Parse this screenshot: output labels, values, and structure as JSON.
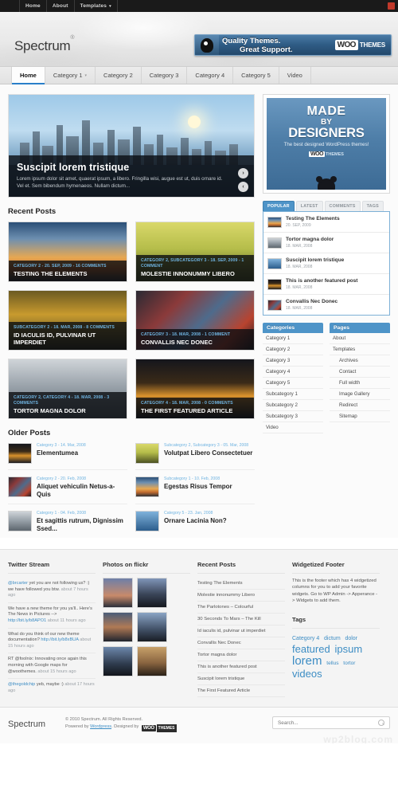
{
  "adminbar": {
    "items": [
      "Home",
      "About",
      "Templates"
    ],
    "templates_has_caret": true
  },
  "header": {
    "logo": "Spectrum",
    "logo_sup": "®",
    "ad": {
      "line1": "Quality Themes.",
      "line2": "Great Support.",
      "brand_woo": "WOO",
      "brand_themes": "THEMES"
    }
  },
  "nav": {
    "items": [
      "Home",
      "Category 1",
      "Category 2",
      "Category 3",
      "Category 4",
      "Category 5",
      "Video"
    ],
    "active": "Home",
    "caret_on": "Category 1"
  },
  "slider": {
    "title": "Suscipit lorem tristique",
    "excerpt": "Lorem ipsum dolor sit amet, quaerat ipsum, a libero. Fringilla wisi, augue est ut, duis ornare id. Vel et. Sem bibendum hymenaeos. Nullam dictum...",
    "next": "›",
    "prev": "‹"
  },
  "recent_posts": {
    "title": "Recent Posts",
    "items": [
      {
        "cat": "CATEGORY 2 - 20. SEP, 2009 - 16 COMMENTS",
        "title": "TESTING THE ELEMENTS",
        "art": "art-sunset"
      },
      {
        "cat": "CATEGORY 2, SUBCATEGORY 3 - 18. SEP, 2009 - 1 COMMENT",
        "title": "MOLESTIE INNONUMMY LIBERO",
        "art": "art-forest"
      },
      {
        "cat": "SUBCATEGORY 2 - 18. MAR, 2008 - 8 COMMENTS",
        "title": "ID IACULIS ID, PULVINAR UT IMPERDIET",
        "art": "art-autumn"
      },
      {
        "cat": "CATEGORY 3 - 18. MAR, 2008 - 1 COMMENT",
        "title": "CONVALLIS NEC DONEC",
        "art": "art-city"
      },
      {
        "cat": "CATEGORY 2, CATEGORY 4 - 18. MAR, 2008 - 3 COMMENTS",
        "title": "TORTOR MAGNA DOLOR",
        "art": "art-grey"
      },
      {
        "cat": "CATEGORY 4 - 18. MAR, 2008 - 0 COMMENTS",
        "title": "THE FIRST FEATURED ARTICLE",
        "art": "art-night"
      }
    ]
  },
  "sidebar_ad": {
    "made": "MADE",
    "by": "BY",
    "designers": "DESIGNERS",
    "tagline": "The best designed WordPress themes!",
    "brand_woo": "WOO",
    "brand_themes": "THEMES"
  },
  "tabs_widget": {
    "tabs": [
      "POPULAR",
      "LATEST",
      "COMMENTS",
      "TAGS"
    ],
    "active": "POPULAR",
    "items": [
      {
        "title": "Testing The Elements",
        "date": "20. SEP, 2009",
        "art": "art-sunset"
      },
      {
        "title": "Tortor magna dolor",
        "date": "18. MAR, 2008",
        "art": "art-grey"
      },
      {
        "title": "Suscipit lorem tristique",
        "date": "18. MAR, 2008",
        "art": "art-blue"
      },
      {
        "title": "This is another featured post",
        "date": "18. MAR, 2008",
        "art": "art-night"
      },
      {
        "title": "Convallis Nec Donec",
        "date": "18. MAR, 2008",
        "art": "art-city"
      }
    ]
  },
  "categories_widget": {
    "title": "Categories",
    "items": [
      "Category 1",
      "Category 2",
      "Category 3",
      "Category 4",
      "Category 5",
      "Subcategory 1",
      "Subcategory 2",
      "Subcategory 3",
      "Video"
    ]
  },
  "pages_widget": {
    "title": "Pages",
    "items": [
      {
        "label": "About",
        "indent": false
      },
      {
        "label": "Templates",
        "indent": false
      },
      {
        "label": "Archives",
        "indent": true
      },
      {
        "label": "Contact",
        "indent": true
      },
      {
        "label": "Full width",
        "indent": true
      },
      {
        "label": "Image Gallery",
        "indent": true
      },
      {
        "label": "Redirect",
        "indent": true
      },
      {
        "label": "Sitemap",
        "indent": true
      }
    ]
  },
  "older_posts": {
    "title": "Older Posts",
    "items": [
      {
        "meta": "Category 3 - 14. Mar, 2008",
        "title": "Elementumea",
        "art": "art-night"
      },
      {
        "meta": "Subcategory 2, Subcategory 3 - 05. Mar, 2008",
        "title": "Volutpat Libero Consectetuer",
        "art": "art-forest"
      },
      {
        "meta": "Category 2 - 20. Feb, 2008",
        "title": "Aliquet vehiculin Netus-a-Quis",
        "art": "art-city"
      },
      {
        "meta": "Subcategory 1 - 10. Feb, 2008",
        "title": "Egestas Risus Tempor",
        "art": "art-sunset"
      },
      {
        "meta": "Category 1 - 04. Feb, 2008",
        "title": "Et sagittis rutrum, Dignissim Ssed...",
        "art": "art-grey"
      },
      {
        "meta": "Category 5 - 23. Jan, 2008",
        "title": "Ornare Lacinia Non?",
        "art": "art-blue"
      }
    ]
  },
  "footer": {
    "twitter": {
      "title": "Twitter Stream",
      "tweets": [
        {
          "handle": "@brcarter",
          "text": "yet you are not following us? :) we have followed you btw.",
          "ago": "about 7 hours ago"
        },
        {
          "handle": "",
          "text": "We have a new theme for you ya'll.. Here's The News in Pictures -->",
          "link": "http://bit.ly/b8APO1",
          "ago": "about 11 hours ago"
        },
        {
          "handle": "",
          "text": "What do you think of our new theme documentation?",
          "link": "http://bit.ly/b8xBUA",
          "ago": "about 15 hours ago"
        },
        {
          "handle": "@foolnix",
          "text": "RT @foolnix: Innovating once again this morning with Google maps for @woothemes.",
          "ago": "about 15 hours ago"
        },
        {
          "handle": "@thegoldchip",
          "text": "yeb, maybe :)",
          "ago": "about 17 hours ago"
        }
      ]
    },
    "flickr": {
      "title": "Photos on flickr",
      "count": 6
    },
    "recent": {
      "title": "Recent Posts",
      "items": [
        "Testing The Elements",
        "Molestie innonummy Libero",
        "The Parlotones – Colourful",
        "30 Seconds To Mars – The Kill",
        "Id iaculis id, pulvinar ut imperdiet",
        "Convallis Nec Donec",
        "Tortor magna dolor",
        "This is another featured post",
        "Suscipit lorem tristique",
        "The First Featured Article"
      ]
    },
    "widgetized": {
      "title": "Widgetized Footer",
      "text": "This is the footer which has 4 widgetized columns for you to add your favorite widgets. Go to WP Admin -> Apperance -> Widgets to add them."
    },
    "tags": {
      "title": "Tags",
      "items": [
        {
          "label": "Category 4",
          "size": 7
        },
        {
          "label": "dictum",
          "size": 7
        },
        {
          "label": "dolor",
          "size": 7
        },
        {
          "label": "featured",
          "size": 13
        },
        {
          "label": "ipsum",
          "size": 13
        },
        {
          "label": "lorem",
          "size": 15
        },
        {
          "label": "tellus",
          "size": 6.5
        },
        {
          "label": "tortor",
          "size": 6.5
        },
        {
          "label": "videos",
          "size": 13
        }
      ]
    }
  },
  "bottom": {
    "logo": "Spectrum",
    "copyright": "© 2010 Spectrum. All Rights Reserved.",
    "powered_prefix": "Powered by",
    "powered_link": "Wordpress",
    "designed_prefix": ". Designed by",
    "brand_woo": "WOO",
    "brand_themes": "THEMES",
    "search_placeholder": "Search...",
    "watermark": "wp2blog.com"
  }
}
